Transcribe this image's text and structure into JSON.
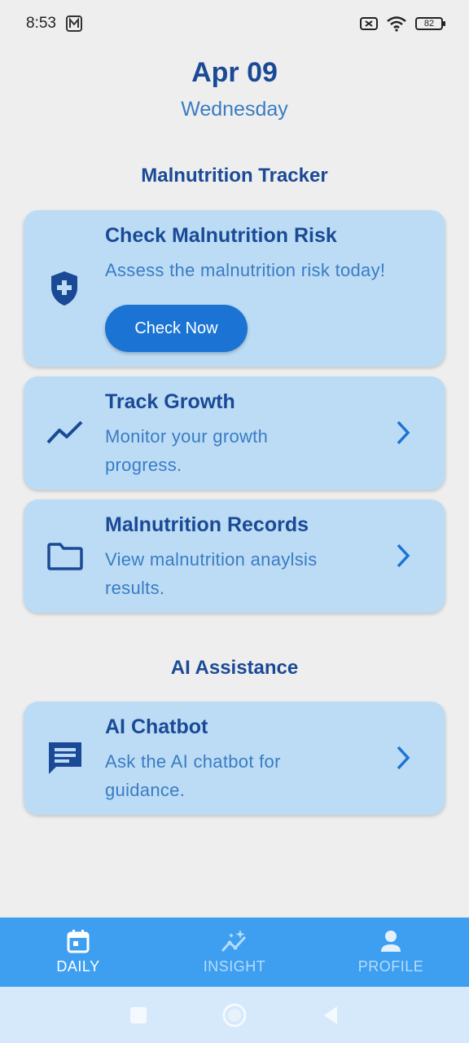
{
  "status_bar": {
    "time": "8:53",
    "battery": "82"
  },
  "header": {
    "date": "Apr 09",
    "weekday": "Wednesday"
  },
  "sections": {
    "tracker_title": "Malnutrition Tracker",
    "ai_title": "AI Assistance"
  },
  "cards": {
    "risk": {
      "title": "Check Malnutrition Risk",
      "desc": "Assess the malnutrition risk today!",
      "button": "Check Now",
      "icon": "shield-plus-icon"
    },
    "growth": {
      "title": "Track Growth",
      "desc_line1": "Monitor your growth",
      "desc_line2": "progress.",
      "icon": "trending-up-icon"
    },
    "records": {
      "title": "Malnutrition Records",
      "desc_line1": "View malnutrition anaylsis",
      "desc_line2": "results.",
      "icon": "folder-icon"
    },
    "chatbot": {
      "title": "AI Chatbot",
      "desc_line1": "Ask the AI chatbot for",
      "desc_line2": "guidance.",
      "icon": "chat-icon"
    }
  },
  "bottom_nav": {
    "items": [
      {
        "label": "DAILY",
        "icon": "calendar-icon",
        "active": true
      },
      {
        "label": "INSIGHT",
        "icon": "insight-icon",
        "active": false
      },
      {
        "label": "PROFILE",
        "icon": "person-icon",
        "active": false
      }
    ]
  },
  "colors": {
    "primary_dark": "#1a4a96",
    "card_bg": "#bcdcf5",
    "button_bg": "#1b74d3",
    "nav_bg": "#3e9ff0"
  }
}
